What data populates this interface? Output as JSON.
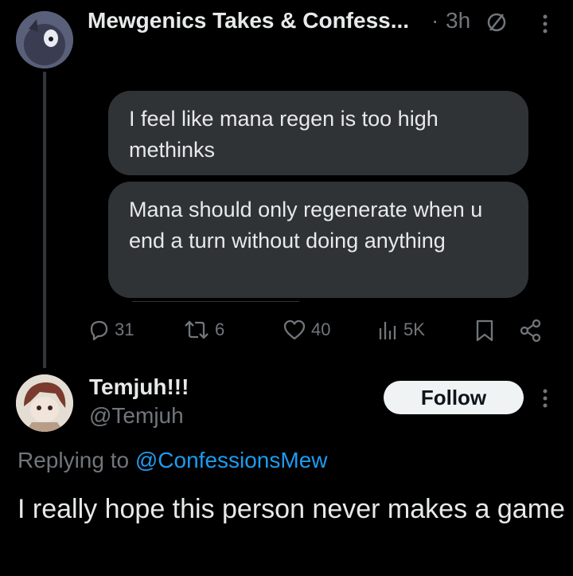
{
  "first_post": {
    "author_name": "Mewgenics Takes & Confess...",
    "separator": "·",
    "time": "3h",
    "bubbles": [
      "I feel like mana regen is too high methinks",
      "Mana should only regenerate when u end a turn without doing anything"
    ],
    "actions": {
      "replies": "31",
      "reposts": "6",
      "likes": "40",
      "views": "5K"
    }
  },
  "reply": {
    "author_name": "Temjuh!!!",
    "handle": "@Temjuh",
    "follow_label": "Follow",
    "replying_prefix": "Replying to",
    "replying_handle": "@ConfessionsMew",
    "text": "I really hope this person never makes a game"
  },
  "colors": {
    "background": "#000000",
    "text": "#e7e9ea",
    "muted": "#71767b",
    "link": "#1d9bf0",
    "bubble": "#2f3336"
  }
}
